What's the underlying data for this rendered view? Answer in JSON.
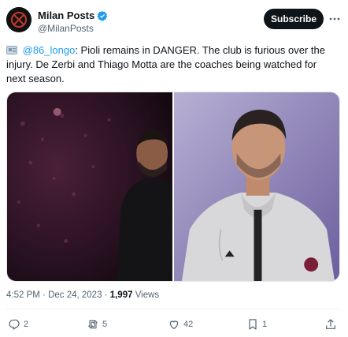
{
  "account": {
    "name": "Milan Posts",
    "handle": "@MilanPosts",
    "verified": true
  },
  "subscribe_label": "Subscribe",
  "tweet": {
    "mention": "@86_longo",
    "text_after_mention": ": Pioli remains in DANGER. The club is furious over the injury. De Zerbi and Thiago Motta are the coaches being watched for next season."
  },
  "meta": {
    "time": "4:52 PM",
    "date": "Dec 24, 2023",
    "views_count": "1,997",
    "views_label": "Views"
  },
  "actions": {
    "replies": "2",
    "reposts": "5",
    "likes": "42",
    "bookmarks": "1"
  },
  "colors": {
    "accent": "#1d9bf0",
    "text": "#0f1419",
    "secondary": "#536471",
    "button": "#0f1419"
  },
  "icons": [
    "verified-badge-icon",
    "more-options-icon",
    "newspaper-icon",
    "reply-icon",
    "repost-icon",
    "like-icon",
    "bookmark-icon",
    "share-icon"
  ]
}
